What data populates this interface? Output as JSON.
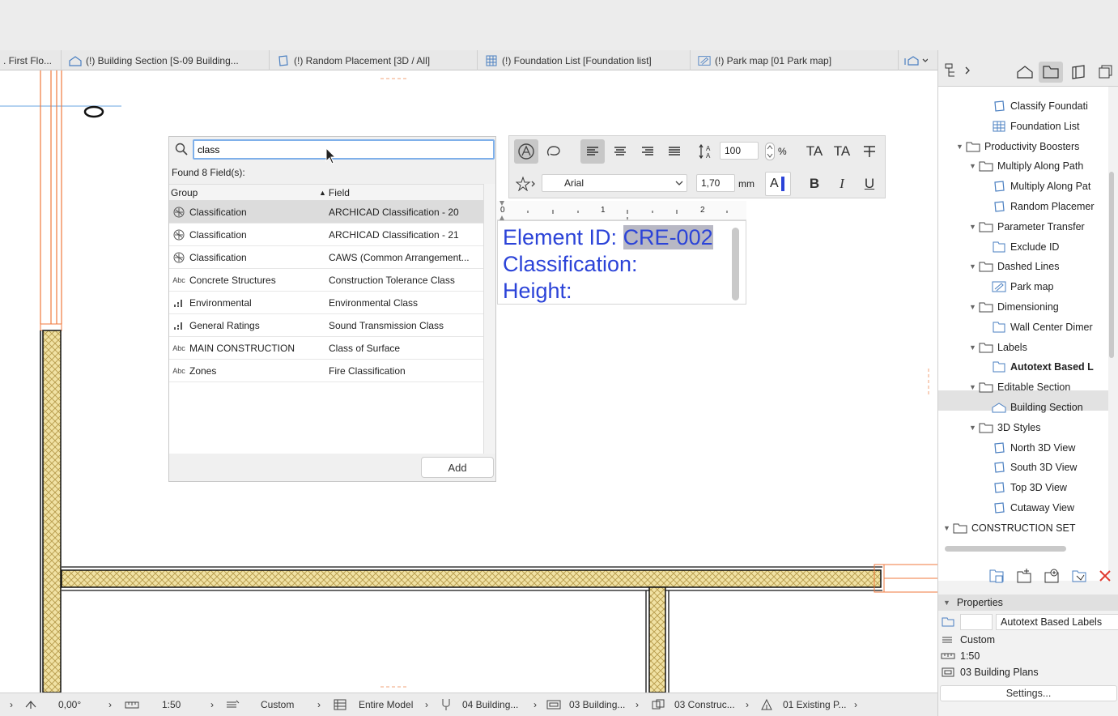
{
  "tabs": [
    {
      "label": ". First Flo..."
    },
    {
      "label": "(!) Building Section [S-09 Building..."
    },
    {
      "label": "(!) Random Placement [3D / All]"
    },
    {
      "label": "(!) Foundation List [Foundation list]"
    },
    {
      "label": "(!) Park map [01 Park map]"
    }
  ],
  "field_dialog": {
    "search_value": "class",
    "found_text": "Found 8 Field(s):",
    "col_group": "Group",
    "col_field": "Field",
    "rows": [
      {
        "group": "Classification",
        "field": "ARCHICAD Classification - 20",
        "icon": "classification-icon",
        "selected": true
      },
      {
        "group": "Classification",
        "field": "ARCHICAD Classification - 21",
        "icon": "classification-icon"
      },
      {
        "group": "Classification",
        "field": "CAWS (Common Arrangement...",
        "icon": "classification-icon"
      },
      {
        "group": "Concrete Structures",
        "field": "Construction Tolerance Class",
        "icon": "abc-icon"
      },
      {
        "group": "Environmental",
        "field": "Environmental Class",
        "icon": "bars-icon"
      },
      {
        "group": "General Ratings",
        "field": "Sound Transmission Class",
        "icon": "bars-icon"
      },
      {
        "group": "MAIN CONSTRUCTION",
        "field": "Class of Surface",
        "icon": "abc-icon"
      },
      {
        "group": "Zones",
        "field": "Fire Classification",
        "icon": "abc-icon"
      }
    ],
    "add_label": "Add"
  },
  "text_toolbar": {
    "scale_value": "100",
    "scale_unit": "%",
    "font_name": "Arial",
    "size_value": "1,70",
    "size_unit": "mm",
    "superscript": "TA",
    "subscript": "TA",
    "bold": "B",
    "italic": "I",
    "underline": "U"
  },
  "ruler": {
    "marks": [
      "0",
      "1",
      "2"
    ]
  },
  "label_text": {
    "line1_prefix": "Element ID: ",
    "line1_value": "CRE-002",
    "line2": "Classification:",
    "line3": "Height:"
  },
  "status_bar": {
    "angle": "0,00°",
    "scale": "1:50",
    "pen_set": "Custom",
    "model_filter": "Entire Model",
    "renovation": "04 Building...",
    "layer_combo": "03 Building...",
    "structure": "03 Construc...",
    "view": "01 Existing P..."
  },
  "navigator": {
    "items": [
      {
        "label": "Classify Foundati",
        "depth": 3,
        "type": "3d"
      },
      {
        "label": "Foundation List",
        "depth": 3,
        "type": "list"
      },
      {
        "label": "Productivity Boosters",
        "depth": 1,
        "type": "folder",
        "expanded": true
      },
      {
        "label": "Multiply Along Path",
        "depth": 2,
        "type": "folder",
        "expanded": true
      },
      {
        "label": "Multiply Along Pat",
        "depth": 3,
        "type": "3d"
      },
      {
        "label": "Random Placemer",
        "depth": 3,
        "type": "3d"
      },
      {
        "label": "Parameter Transfer",
        "depth": 2,
        "type": "folder",
        "expanded": true
      },
      {
        "label": "Exclude ID",
        "depth": 3,
        "type": "plan"
      },
      {
        "label": "Dashed Lines",
        "depth": 2,
        "type": "folder",
        "expanded": true
      },
      {
        "label": "Park map",
        "depth": 3,
        "type": "map"
      },
      {
        "label": "Dimensioning",
        "depth": 2,
        "type": "folder",
        "expanded": true
      },
      {
        "label": "Wall Center Dimer",
        "depth": 3,
        "type": "plan"
      },
      {
        "label": "Labels",
        "depth": 2,
        "type": "folder",
        "expanded": true
      },
      {
        "label": "Autotext Based L",
        "depth": 3,
        "type": "plan",
        "selected": true
      },
      {
        "label": "Editable Section",
        "depth": 2,
        "type": "folder",
        "expanded": true
      },
      {
        "label": "Building Section",
        "depth": 3,
        "type": "section"
      },
      {
        "label": "3D Styles",
        "depth": 2,
        "type": "folder",
        "expanded": true
      },
      {
        "label": "North 3D View",
        "depth": 3,
        "type": "3d"
      },
      {
        "label": "South 3D View",
        "depth": 3,
        "type": "3d"
      },
      {
        "label": "Top 3D View",
        "depth": 3,
        "type": "3d"
      },
      {
        "label": "Cutaway View",
        "depth": 3,
        "type": "3d"
      },
      {
        "label": "CONSTRUCTION SET",
        "depth": 0,
        "type": "folder",
        "expanded": true
      }
    ]
  },
  "properties": {
    "header": "Properties",
    "id_value": "",
    "name_value": "Autotext Based Labels",
    "pen_set": "Custom",
    "scale": "1:50",
    "layer": "03 Building Plans",
    "settings_label": "Settings..."
  },
  "colors": {
    "accent_blue": "#2b43d8",
    "selection_gray": "#dcdcdc",
    "wall_orange": "#f07a3c",
    "insulation_yellow": "#f1e2a4",
    "delete_red": "#e03a2f"
  }
}
